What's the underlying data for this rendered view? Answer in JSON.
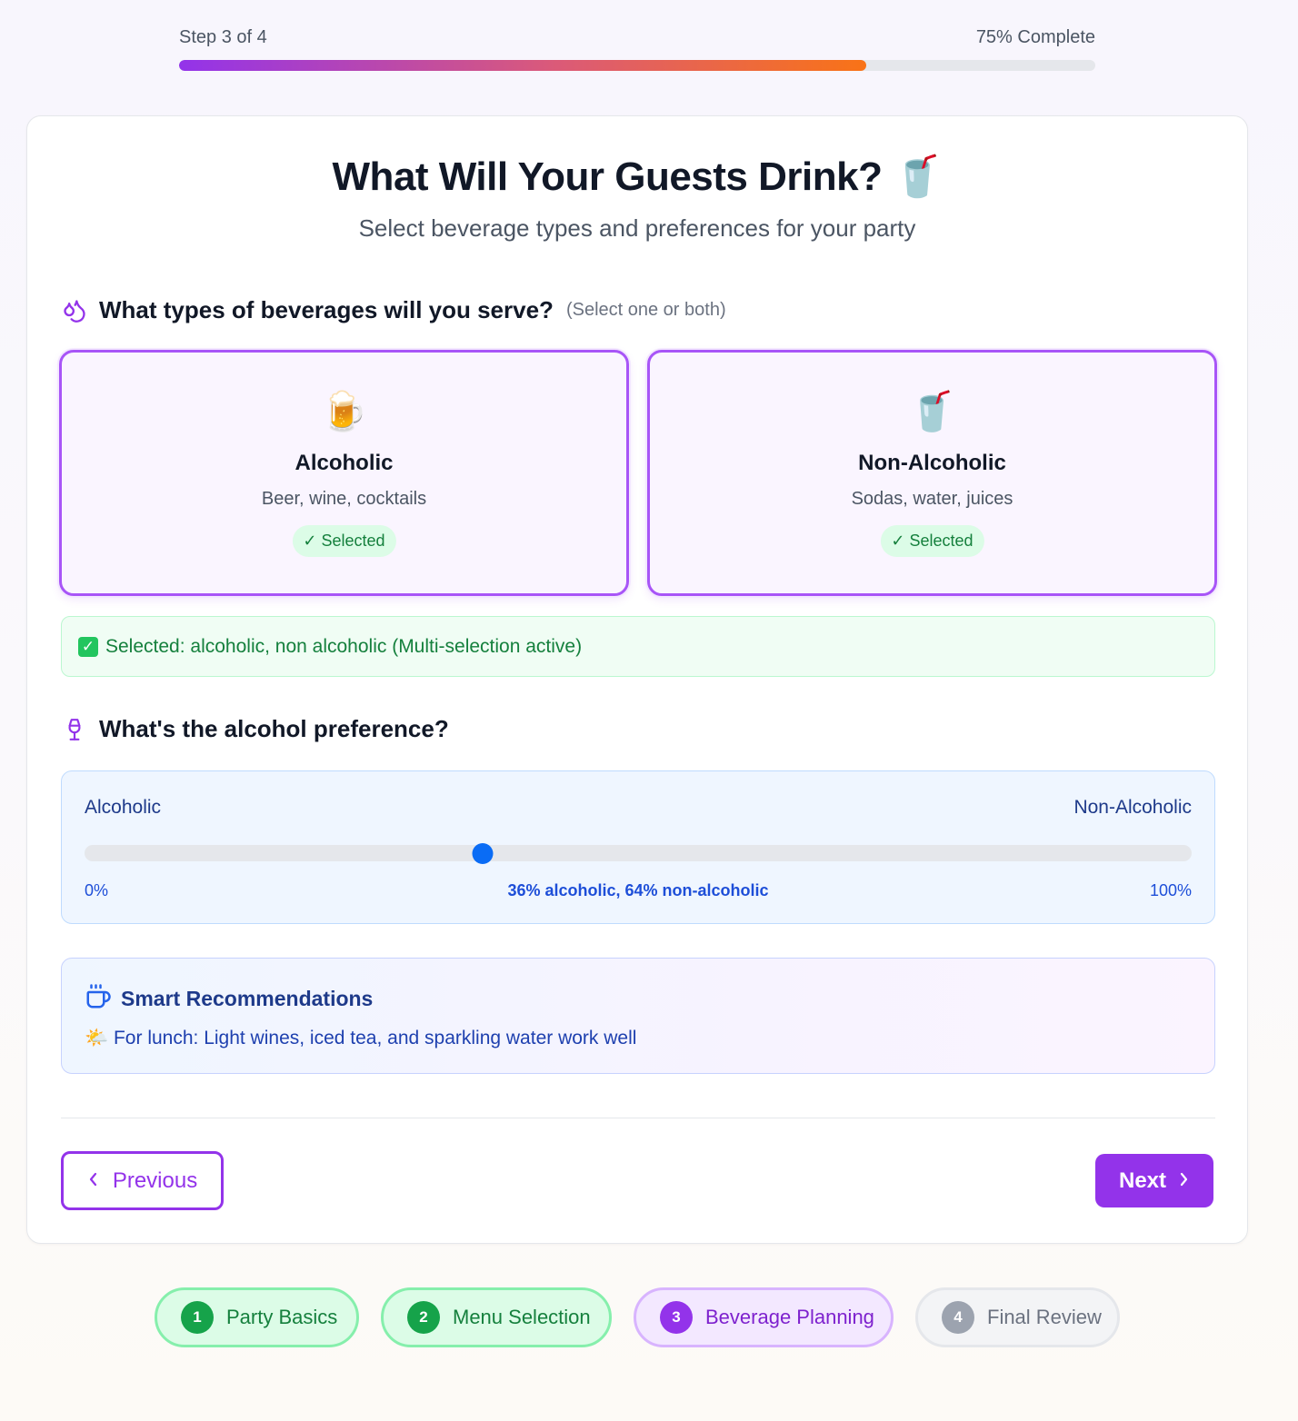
{
  "progress": {
    "step_text": "Step 3 of 4",
    "complete_text": "75% Complete",
    "fraction": 0.75
  },
  "header": {
    "title": "What Will Your Guests Drink? 🥤",
    "subtitle": "Select beverage types and preferences for your party"
  },
  "beverage_types": {
    "question": "What types of beverages will you serve?",
    "hint": "(Select one or both)",
    "icon": "droplets-icon",
    "options": [
      {
        "emoji": "🍺",
        "name": "Alcoholic",
        "description": "Beer, wine, cocktails",
        "badge": "✓ Selected",
        "selected": true
      },
      {
        "emoji": "🥤",
        "name": "Non-Alcoholic",
        "description": "Sodas, water, juices",
        "badge": "✓ Selected",
        "selected": true
      }
    ],
    "selected_summary": "Selected: alcoholic, non alcoholic (Multi-selection active)"
  },
  "alcohol_preference": {
    "question": "What's the alcohol preference?",
    "icon": "wine-glass-icon",
    "left_label": "Alcoholic",
    "right_label": "Non-Alcoholic",
    "min_label": "0%",
    "max_label": "100%",
    "value_text": "36% alcoholic, 64% non-alcoholic",
    "value": 0.36
  },
  "recommendations": {
    "icon": "coffee-cup-icon",
    "title": "Smart Recommendations",
    "tip": "🌤️ For lunch: Light wines, iced tea, and sparkling water work well"
  },
  "nav": {
    "previous_label": "Previous",
    "next_label": "Next"
  },
  "steps": [
    {
      "number": "1",
      "label": "Party Basics",
      "state": "done"
    },
    {
      "number": "2",
      "label": "Menu Selection",
      "state": "done"
    },
    {
      "number": "3",
      "label": "Beverage Planning",
      "state": "active"
    },
    {
      "number": "4",
      "label": "Final Review",
      "state": "pending"
    }
  ],
  "colors": {
    "accent": "#9333ea",
    "success": "#16a34a",
    "slider_thumb": "#0a6cf5"
  }
}
